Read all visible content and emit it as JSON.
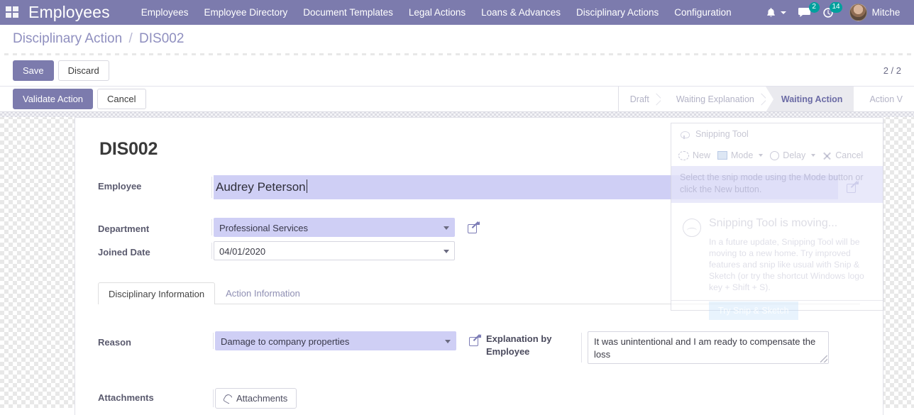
{
  "navbar": {
    "apps_icon": "apps-grid-icon",
    "brand": "Employees",
    "menus": [
      {
        "label": "Employees"
      },
      {
        "label": "Employee Directory"
      },
      {
        "label": "Document Templates"
      },
      {
        "label": "Legal Actions"
      },
      {
        "label": "Loans & Advances"
      },
      {
        "label": "Disciplinary Actions"
      },
      {
        "label": "Configuration"
      }
    ],
    "systray": {
      "bell_icon": "bell-icon",
      "messages_icon": "chat-bubble-icon",
      "messages_count": "2",
      "activities_icon": "clock-activity-icon",
      "activities_count": "14",
      "avatar_icon": "avatar",
      "username": "Mitche"
    }
  },
  "breadcrumb": {
    "parent": "Disciplinary Action",
    "separator": "/",
    "current": "DIS002"
  },
  "actions": {
    "save_label": "Save",
    "discard_label": "Discard",
    "pager": "2 / 2"
  },
  "statusbar": {
    "validate_label": "Validate Action",
    "cancel_label": "Cancel",
    "states": [
      {
        "label": "Draft",
        "active": false
      },
      {
        "label": "Waiting Explanation",
        "active": false
      },
      {
        "label": "Waiting Action",
        "active": true
      },
      {
        "label": "Action V",
        "active": false
      }
    ]
  },
  "form": {
    "record_title": "DIS002",
    "employee": {
      "label": "Employee",
      "value": "Audrey Peterson",
      "placeholder": "",
      "external_link_icon": "external-link-icon"
    },
    "department": {
      "label": "Department",
      "value": "Professional Services",
      "external_link_icon": "external-link-icon"
    },
    "joined_date": {
      "label": "Joined Date",
      "value": "04/01/2020"
    },
    "tabs": [
      {
        "label": "Disciplinary Information",
        "active": true
      },
      {
        "label": "Action Information",
        "active": false
      }
    ],
    "reason": {
      "label": "Reason",
      "value": "Damage to company properties",
      "external_link_icon": "external-link-icon"
    },
    "explanation": {
      "label": "Explanation by Employee",
      "value": "It was unintentional and I am ready to compensate the loss"
    },
    "attachments": {
      "label": "Attachments",
      "button_label": "Attachments",
      "icon": "paperclip-icon"
    }
  },
  "snipping_tool": {
    "title": "Snipping Tool",
    "app_icon": "scissors-icon",
    "toolbar": {
      "new_label": "New",
      "mode_label": "Mode",
      "delay_label": "Delay",
      "cancel_label": "Cancel"
    },
    "tip": "Select the snip mode using the Mode button or click the New button.",
    "promo": {
      "heading": "Snipping Tool is moving...",
      "body": "In a future update, Snipping Tool will be moving to a new home. Try improved features and snip like usual with Snip & Sketch (or try the shortcut Windows logo key + Shift + S).",
      "cta_label": "Try Snip & Sketch",
      "icon": "picture-icon"
    }
  },
  "theme": {
    "brand_purple": "#7c7bad",
    "selection_lilac": "#cfcff5",
    "badge_teal": "#00a09d",
    "breadcrumb_color": "#8f8fbf"
  }
}
